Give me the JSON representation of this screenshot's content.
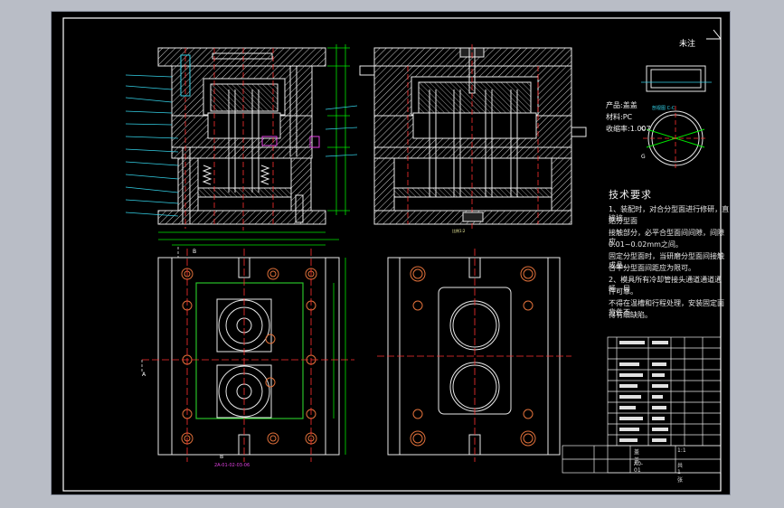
{
  "drawing": {
    "surface_mark": "未注",
    "section_label": "剖视图 C-C",
    "product": {
      "name_label": "产品:",
      "name": "盖盖",
      "material_label": "材料:",
      "material": "PC",
      "shrink_label": "收缩率:",
      "shrink": "1.007"
    },
    "tech_title": "技术要求",
    "requirements": [
      "1、装配时，对合分型面进行修研，直接接",
      "  贴分型面",
      "接触部分，必平合型面间间隙，间隙应",
      "0.01~0.02mm之间。",
      "固定分型面时，当研磨分型面间接触成品，",
      "  合平分型面间距应为限可。",
      "2、模具所有冷却管接头通道通道通畅，导",
      "  件可靠。",
      "不得在温槽和行程处理，安装固定面背件不",
      "得有细缺陷。"
    ],
    "section_mark_left": "A",
    "section_mark_top": "B",
    "section_mark_bottom": "B",
    "view_mark_c": "C",
    "view_mark_g": "G",
    "dim_label_pink": "2A-01-02-03-06",
    "scale_note": "比例1:2",
    "title_block": {
      "name": "盖盖",
      "scale": "1:1",
      "sheet": "共1张",
      "drawing_no": "A0-01"
    }
  },
  "colors": {
    "background": "#000000",
    "frame": "#ffffff",
    "outline": "#e9e9e9",
    "hatch": "#c9c9c9",
    "center": "#ff3030",
    "dim": "#00e500",
    "hole": "#e0703a",
    "cyan": "#33d0e6",
    "pink": "#e040e0",
    "yellow": "#f0f070"
  }
}
